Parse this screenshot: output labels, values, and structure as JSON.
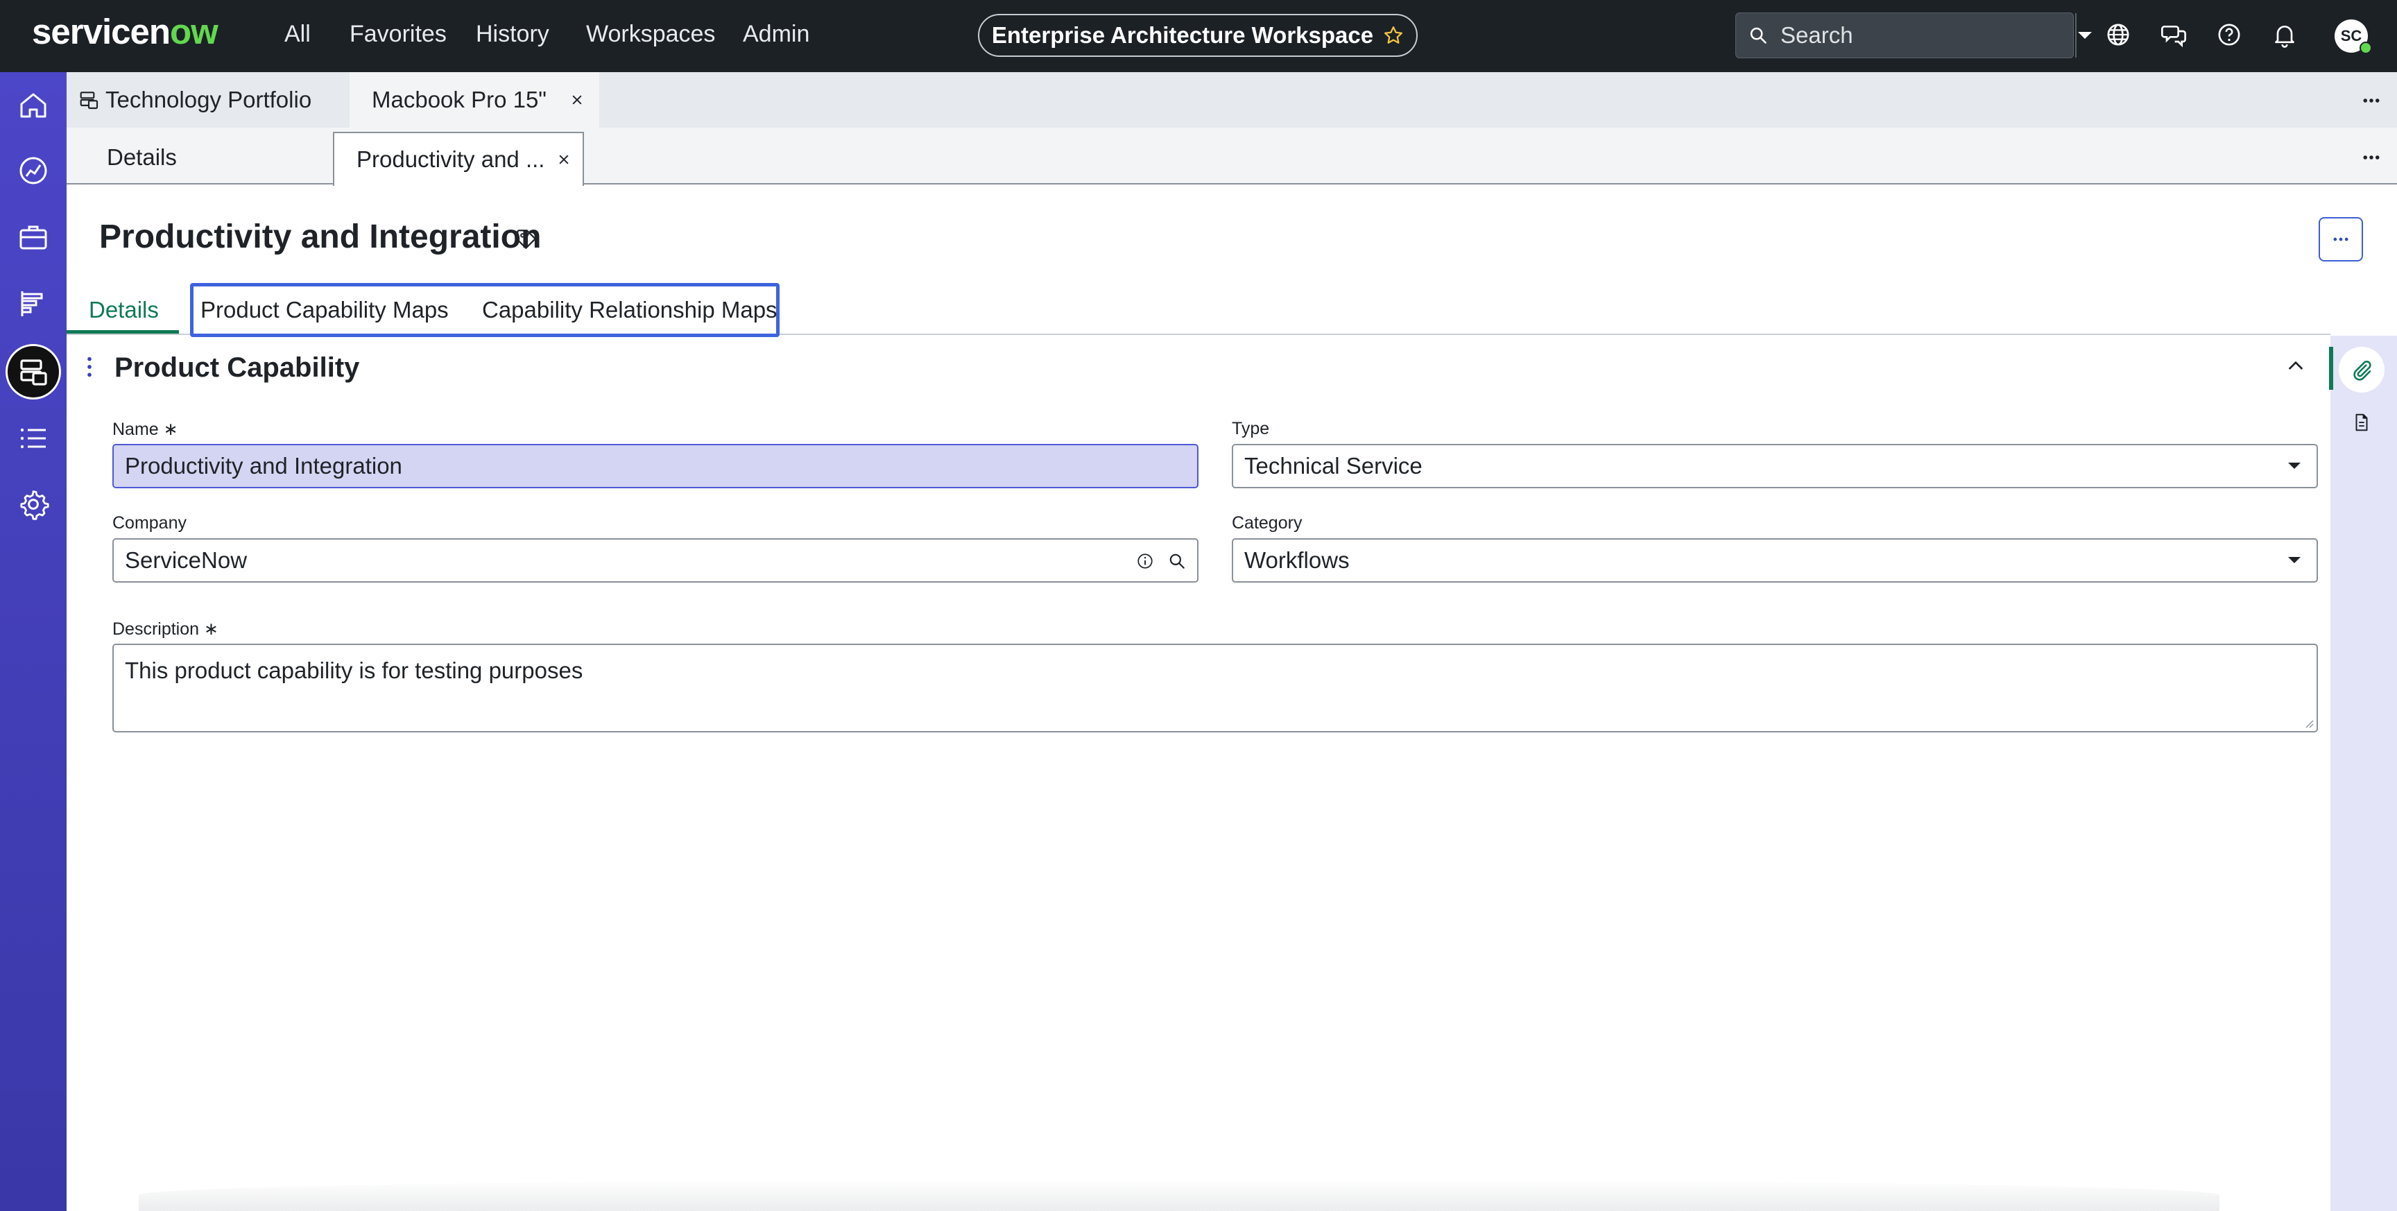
{
  "topbar": {
    "logo_prefix": "servicen",
    "logo_ow": "ow",
    "nav": [
      "All",
      "Favorites",
      "History",
      "Workspaces",
      "Admin"
    ],
    "workspace_title": "Enterprise Architecture Workspace",
    "search_placeholder": "Search",
    "avatar_initials": "SC"
  },
  "tabs_level1": [
    {
      "label": "Technology Portfolio"
    },
    {
      "label": "Macbook Pro 15\""
    }
  ],
  "tabs_level2": [
    {
      "label": "Details"
    },
    {
      "label": "Productivity and ..."
    }
  ],
  "record": {
    "title": "Productivity and Integration"
  },
  "subtabs": [
    "Details",
    "Product Capability Maps",
    "Capability Relationship Maps"
  ],
  "form": {
    "section_title": "Product Capability",
    "name_label": "Name",
    "name_value": "Productivity and Integration",
    "type_label": "Type",
    "type_value": "Technical Service",
    "company_label": "Company",
    "company_value": "ServiceNow",
    "category_label": "Category",
    "category_value": "Workflows",
    "description_label": "Description",
    "description_value": "This product capability is for testing purposes",
    "required_mark": "∗"
  },
  "colors": {
    "topbar": "#1c2126",
    "rail": "#4c46c8",
    "accent_green": "#0f7a55",
    "focus_blue": "#3d63dd"
  }
}
